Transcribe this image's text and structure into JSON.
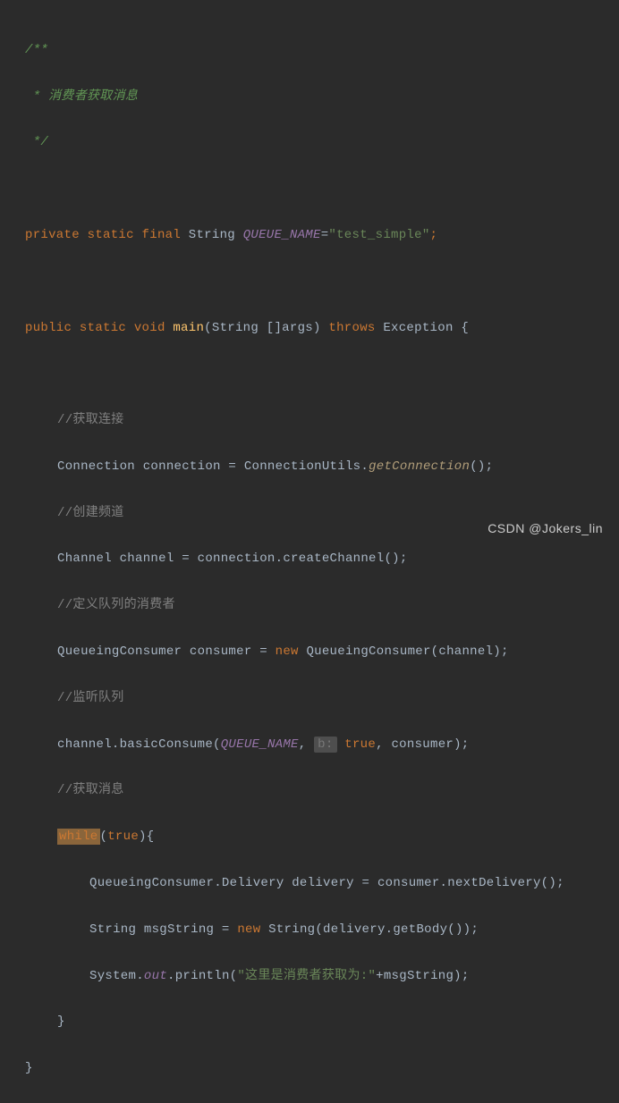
{
  "doc_comment": {
    "open": "/**",
    "body": " * 消费者获取消息",
    "close": " */"
  },
  "decl": {
    "private": "private",
    "static": "static",
    "final": "final",
    "type": "String",
    "name": "QUEUE_NAME",
    "eq": "=",
    "value": "\"test_simple\"",
    "semi": ";"
  },
  "main": {
    "public": "public",
    "static": "static",
    "void": "void",
    "name": "main",
    "params_open": "(",
    "params": "String []args",
    "params_close": ")",
    "throws": "throws",
    "exc": "Exception",
    "brace": " {"
  },
  "c1": "//获取连接",
  "l1a": "Connection connection = ConnectionUtils.",
  "l1b": "getConnection",
  "l1c": "();",
  "c2": "//创建频道",
  "l2": "Channel channel = connection.createChannel();",
  "c3": "//定义队列的消费者",
  "l3a": "QueueingConsumer consumer = ",
  "l3new": "new",
  "l3b": " QueueingConsumer(channel);",
  "c4": "//监听队列",
  "l4a": "channel.basicConsume(",
  "l4q": "QUEUE_NAME",
  "l4comma1": ", ",
  "l4hint": "b:",
  "l4true": " true",
  "l4comma2": ", consumer);",
  "c5": "//获取消息",
  "while": "while",
  "while_open": "(",
  "while_true": "true",
  "while_close": "){",
  "l5": "QueueingConsumer.Delivery delivery = consumer.nextDelivery();",
  "l6a": "String msgString = ",
  "l6new": "new",
  "l6b": " String(delivery.getBody());",
  "l7a": "System.",
  "l7out": "out",
  "l7b": ".println(",
  "l7str": "\"这里是消费者获取为:\"",
  "l7c": "+msgString);",
  "close_while": "}",
  "close_main": "}",
  "watermark": "CSDN @Jokers_lin"
}
